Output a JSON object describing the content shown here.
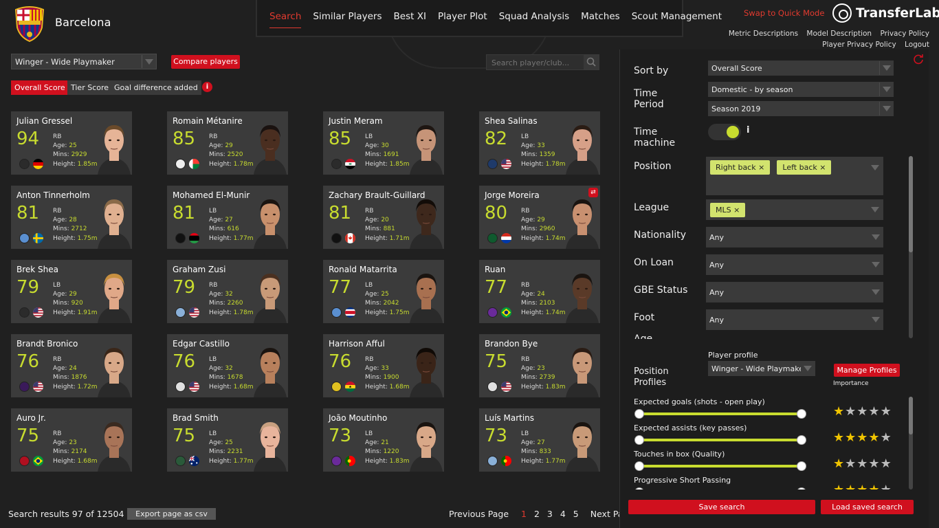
{
  "header": {
    "club_name": "Barcelona",
    "nav": [
      "Search",
      "Similar Players",
      "Best XI",
      "Player Plot",
      "Squad Analysis",
      "Matches",
      "Scout Management"
    ],
    "active_nav": "Search",
    "quick_mode": "Swap to Quick Mode",
    "logo_text": "TransferLab",
    "links_row1": [
      "Metric Descriptions",
      "Model Description",
      "Privacy Policy"
    ],
    "links_row2": [
      "Player Privacy Policy",
      "Logout"
    ]
  },
  "filters": {
    "profile_select": "Winger - Wide Playmaker",
    "compare_button": "Compare players",
    "search_placeholder": "Search player/club...",
    "score_tabs": [
      "Overall Score",
      "Tier Score",
      "Goal difference added"
    ],
    "info": "i"
  },
  "card_stat_labels": {
    "age": "Age: ",
    "mins": "Mins: ",
    "height": "Height: "
  },
  "players": [
    {
      "name": "Julian Gressel",
      "score": "94",
      "pos": "RB",
      "age": "25",
      "mins": "2929",
      "height": "1.85m",
      "club_color": "#2b2b2b",
      "flag": "de",
      "photo": {
        "skin": "#e6b497",
        "hair": "#6a4a2a"
      }
    },
    {
      "name": "Romain Métanire",
      "score": "85",
      "pos": "RB",
      "age": "29",
      "mins": "2520",
      "height": "1.78m",
      "club_color": "#eeeeee",
      "flag": "mg",
      "photo": {
        "skin": "#4a2e20",
        "hair": "#1a1210"
      }
    },
    {
      "name": "Justin Meram",
      "score": "85",
      "pos": "LB",
      "age": "30",
      "mins": "1691",
      "height": "1.85m",
      "club_color": "#2b2b2b",
      "flag": "iq",
      "photo": {
        "skin": "#c69478",
        "hair": "#1e1612"
      }
    },
    {
      "name": "Shea Salinas",
      "score": "82",
      "pos": "LB",
      "age": "33",
      "mins": "1359",
      "height": "1.78m",
      "club_color": "#1e3a6a",
      "flag": "us",
      "photo": {
        "skin": "#d6a088",
        "hair": "#2a1c14"
      }
    },
    {
      "name": "Anton Tinnerholm",
      "score": "81",
      "pos": "RB",
      "age": "28",
      "mins": "2712",
      "height": "1.75m",
      "club_color": "#5a8fd0",
      "flag": "se",
      "photo": {
        "skin": "#e0b090",
        "hair": "#8a6a48"
      }
    },
    {
      "name": "Mohamed El-Munir",
      "score": "81",
      "pos": "LB",
      "age": "27",
      "mins": "616",
      "height": "1.77m",
      "club_color": "#111111",
      "flag": "ly",
      "photo": {
        "skin": "#c8906c",
        "hair": "#1a1410"
      }
    },
    {
      "name": "Zachary Brault-Guillard",
      "score": "81",
      "pos": "RB",
      "age": "20",
      "mins": "881",
      "height": "1.71m",
      "club_color": "#111111",
      "flag": "ca",
      "photo": {
        "skin": "#3e281c",
        "hair": "#120c08"
      }
    },
    {
      "name": "Jorge Moreira",
      "score": "80",
      "pos": "RB",
      "age": "29",
      "mins": "2960",
      "height": "1.74m",
      "club_color": "#0f5a2e",
      "flag": "py",
      "photo": {
        "skin": "#c89070",
        "hair": "#1a1410"
      },
      "swap": "⇄"
    },
    {
      "name": "Brek Shea",
      "score": "79",
      "pos": "LB",
      "age": "29",
      "mins": "920",
      "height": "1.91m",
      "club_color": "#2b2b2b",
      "flag": "us",
      "photo": {
        "skin": "#e0a888",
        "hair": "#c89040"
      }
    },
    {
      "name": "Graham Zusi",
      "score": "79",
      "pos": "RB",
      "age": "32",
      "mins": "2260",
      "height": "1.78m",
      "club_color": "#8ab0d8",
      "flag": "us",
      "photo": {
        "skin": "#c89a78",
        "hair": "#4a3020"
      }
    },
    {
      "name": "Ronald Matarrita",
      "score": "77",
      "pos": "LB",
      "age": "25",
      "mins": "2042",
      "height": "1.75m",
      "club_color": "#5a8fd0",
      "flag": "cr",
      "photo": {
        "skin": "#a87050",
        "hair": "#1a1410"
      }
    },
    {
      "name": "Ruan",
      "score": "77",
      "pos": "RB",
      "age": "24",
      "mins": "2103",
      "height": "1.74m",
      "club_color": "#6a2a9a",
      "flag": "br",
      "photo": {
        "skin": "#5a3a28",
        "hair": "#1a1410"
      }
    },
    {
      "name": "Brandt Bronico",
      "score": "76",
      "pos": "RB",
      "age": "24",
      "mins": "1876",
      "height": "1.72m",
      "club_color": "#3a1a5a",
      "flag": "us",
      "photo": {
        "skin": "#d8a888",
        "hair": "#3a2618"
      }
    },
    {
      "name": "Edgar Castillo",
      "score": "76",
      "pos": "LB",
      "age": "32",
      "mins": "1678",
      "height": "1.68m",
      "club_color": "#e0e0e0",
      "flag": "us",
      "photo": {
        "skin": "#b8805c",
        "hair": "#1a1410"
      }
    },
    {
      "name": "Harrison Afful",
      "score": "76",
      "pos": "RB",
      "age": "33",
      "mins": "1900",
      "height": "1.68m",
      "club_color": "#e0c020",
      "flag": "gh",
      "photo": {
        "skin": "#3a2418",
        "hair": "#100a06"
      }
    },
    {
      "name": "Brandon Bye",
      "score": "75",
      "pos": "RB",
      "age": "23",
      "mins": "2739",
      "height": "1.83m",
      "club_color": "#e0e0e0",
      "flag": "us",
      "photo": {
        "skin": "#c89878",
        "hair": "#2a1c14"
      }
    },
    {
      "name": "Auro Jr.",
      "score": "75",
      "pos": "RB",
      "age": "23",
      "mins": "2174",
      "height": "1.68m",
      "club_color": "#b01020",
      "flag": "br",
      "photo": {
        "skin": "#a87458",
        "hair": "#3a2a20"
      }
    },
    {
      "name": "Brad Smith",
      "score": "75",
      "pos": "LB",
      "age": "25",
      "mins": "2231",
      "height": "1.77m",
      "club_color": "#2a5a3a",
      "flag": "au",
      "photo": {
        "skin": "#e8b49c",
        "hair": "#c8a080"
      }
    },
    {
      "name": "João Moutinho",
      "score": "73",
      "pos": "LB",
      "age": "21",
      "mins": "1220",
      "height": "1.83m",
      "club_color": "#6a2a9a",
      "flag": "pt",
      "photo": {
        "skin": "#d8a888",
        "hair": "#1a1410"
      }
    },
    {
      "name": "Luís Martins",
      "score": "73",
      "pos": "LB",
      "age": "27",
      "mins": "833",
      "height": "1.77m",
      "club_color": "#8ab0d8",
      "flag": "pt",
      "photo": {
        "skin": "#c89a78",
        "hair": "#1a1410"
      }
    }
  ],
  "footer": {
    "results": "Search results 97 of 12504",
    "export": "Export page as csv",
    "prev": "Previous Page",
    "pages": [
      "1",
      "2",
      "3",
      "4",
      "5"
    ],
    "current_page": "1",
    "next": "Next Page"
  },
  "panel": {
    "sort_by_label": "Sort by",
    "sort_by": "Overall Score",
    "time_period_label": "Time Period",
    "time_period": "Domestic - by season",
    "season": "Season 2019",
    "time_machine_label": "Time machine",
    "time_machine_on": true,
    "time_machine_info": "i",
    "position_label": "Position",
    "positions": [
      "Right back",
      "Left back"
    ],
    "league_label": "League",
    "leagues": [
      "MLS"
    ],
    "chip_remove": "×",
    "nationality_label": "Nationality",
    "nationality": "Any",
    "on_loan_label": "On Loan",
    "on_loan": "Any",
    "gbe_label": "GBE Status",
    "gbe": "Any",
    "foot_label": "Foot",
    "foot": "Any",
    "age_label": "Age",
    "position_profiles_label": "Position Profiles",
    "player_profile_label": "Player profile",
    "player_profile": "Winger - Wide Playmaker",
    "manage_profiles": "Manage Profiles",
    "importance_label": "Importance",
    "metrics": [
      {
        "label": "Expected goals (shots - open play)",
        "stars": 1
      },
      {
        "label": "Expected assists (key passes)",
        "stars": 4
      },
      {
        "label": "Touches in box (Quality)",
        "stars": 1
      },
      {
        "label": "Progressive Short Passing",
        "stars": 4
      }
    ],
    "save_search": "Save search",
    "load_search": "Load saved search"
  },
  "colors": {
    "accent_red": "#d0101e",
    "score_lime": "#c8dc2f",
    "chip": "#d2e36e"
  }
}
